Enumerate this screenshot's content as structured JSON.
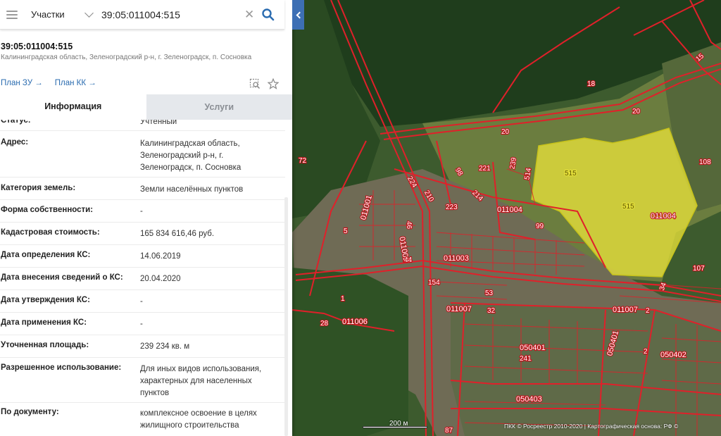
{
  "search": {
    "category": "Участки",
    "query": "39:05:011004:515"
  },
  "object": {
    "number": "39:05:011004:515",
    "address": "Калининградская область, Зеленоградский р-н, г. Зеленоградск, п. Сосновка",
    "links": [
      "План ЗУ →",
      "План КК →"
    ]
  },
  "tabs": [
    "Информация",
    "Услуги"
  ],
  "info_rows": [
    {
      "label": "Статус:",
      "value": "Учтенный"
    },
    {
      "label": "Адрес:",
      "value": "Калининградская область, Зеленоградский р-н, г. Зеленоградск, п. Сосновка"
    },
    {
      "label": "Категория земель:",
      "value": "Земли населённых пунктов"
    },
    {
      "label": "Форма собственности:",
      "value": "-"
    },
    {
      "label": "Кадастровая стоимость:",
      "value": "165 834 616,46 руб."
    },
    {
      "label": "Дата определения КС:",
      "value": "14.06.2019"
    },
    {
      "label": "Дата внесения сведений о КС:",
      "value": "20.04.2020"
    },
    {
      "label": "Дата утверждения КС:",
      "value": "-"
    },
    {
      "label": "Дата применения КС:",
      "value": "-"
    },
    {
      "label": "Уточненная площадь:",
      "value": "239 234 кв. м"
    },
    {
      "label": "Разрешенное использование:",
      "value": "Для иных видов использования, характерных для населенных пунктов"
    },
    {
      "label": "По документу:",
      "value": "комплексное освоение в целях жилищного строительства"
    }
  ],
  "map": {
    "scale_label": "200 м",
    "copyright": "ПКК © Росреестр 2010-2020 | Картографическая основа: РФ ©",
    "highlight_color": "#e8e23a",
    "boundary_color": "#e0202a",
    "labels": [
      {
        "text": "15"
      },
      {
        "text": "18"
      },
      {
        "text": "20"
      },
      {
        "text": "20"
      },
      {
        "text": "72"
      },
      {
        "text": "108"
      },
      {
        "text": "239"
      },
      {
        "text": "514"
      },
      {
        "text": "221"
      },
      {
        "text": "98"
      },
      {
        "text": "224"
      },
      {
        "text": "210"
      },
      {
        "text": "214"
      },
      {
        "text": "223"
      },
      {
        "text": "011004"
      },
      {
        "text": "515"
      },
      {
        "text": "515"
      },
      {
        "text": "011004"
      },
      {
        "text": "99"
      },
      {
        "text": "011001"
      },
      {
        "text": "5"
      },
      {
        "text": "011002"
      },
      {
        "text": "46"
      },
      {
        "text": "011003"
      },
      {
        "text": "44"
      },
      {
        "text": "107"
      },
      {
        "text": "154"
      },
      {
        "text": "53"
      },
      {
        "text": "34"
      },
      {
        "text": "1"
      },
      {
        "text": "011007"
      },
      {
        "text": "32"
      },
      {
        "text": "011007"
      },
      {
        "text": "2"
      },
      {
        "text": "28"
      },
      {
        "text": "011006"
      },
      {
        "text": "050401"
      },
      {
        "text": "241"
      },
      {
        "text": "050401"
      },
      {
        "text": "2"
      },
      {
        "text": "050402"
      },
      {
        "text": "050403"
      },
      {
        "text": "87"
      }
    ]
  }
}
